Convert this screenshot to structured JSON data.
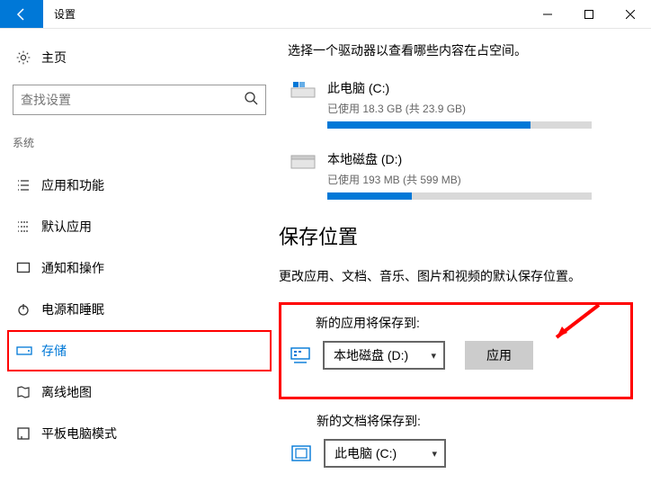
{
  "titlebar": {
    "title": "设置"
  },
  "sidebar": {
    "home": "主页",
    "search_placeholder": "查找设置",
    "group": "系统",
    "items": [
      {
        "label": "应用和功能"
      },
      {
        "label": "默认应用"
      },
      {
        "label": "通知和操作"
      },
      {
        "label": "电源和睡眠"
      },
      {
        "label": "存储"
      },
      {
        "label": "离线地图"
      },
      {
        "label": "平板电脑模式"
      }
    ]
  },
  "content": {
    "hint": "选择一个驱动器以查看哪些内容在占空间。",
    "drives": [
      {
        "name": "此电脑 (C:)",
        "usage": "已使用 18.3 GB (共 23.9 GB)",
        "pct": 77
      },
      {
        "name": "本地磁盘 (D:)",
        "usage": "已使用 193 MB (共 599 MB)",
        "pct": 32
      }
    ],
    "section_title": "保存位置",
    "section_desc": "更改应用、文档、音乐、图片和视频的默认保存位置。",
    "save_blocks": {
      "apps": {
        "label": "新的应用将保存到:",
        "value": "本地磁盘 (D:)",
        "apply": "应用"
      },
      "docs": {
        "label": "新的文档将保存到:",
        "value": "此电脑 (C:)"
      }
    }
  }
}
